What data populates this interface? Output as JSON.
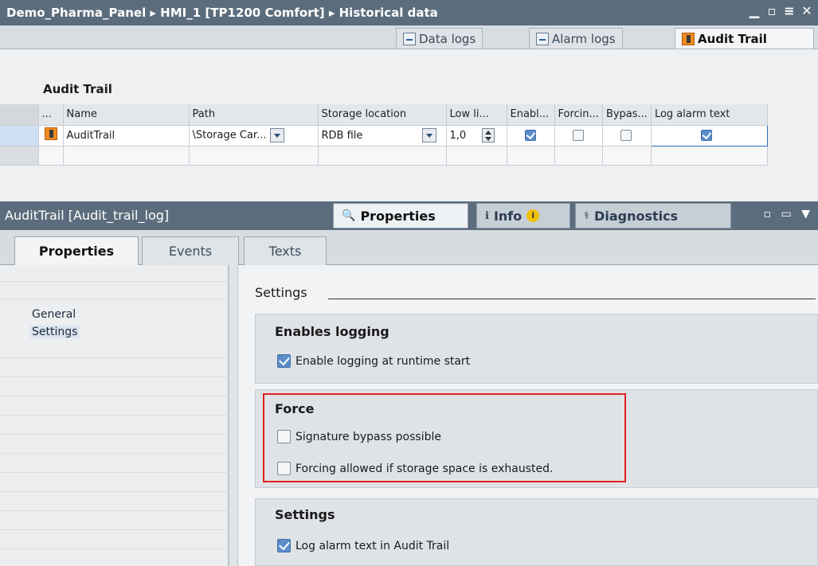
{
  "titlebar": {
    "title": "Demo_Pharma_Panel ▸ HMI_1 [TP1200 Comfort] ▸ Historical data",
    "controls": [
      "minimize",
      "restore",
      "float",
      "close"
    ]
  },
  "editor_tabs": [
    {
      "label": "Data logs",
      "icon": "data-log-icon"
    },
    {
      "label": "Alarm logs",
      "icon": "alarm-log-icon"
    },
    {
      "label": "Audit Trail",
      "icon": "audit-trail-icon",
      "active": true
    }
  ],
  "grid": {
    "title": "Audit Trail",
    "columns": [
      "...",
      "Name",
      "Path",
      "Storage location",
      "Low li...",
      "Enabl...",
      "Forcin...",
      "Bypas...",
      "Log alarm text"
    ],
    "rows": [
      {
        "name": "AuditTrail",
        "path": "\\Storage Car...",
        "storage": "RDB file",
        "low": "1,0",
        "enabled": true,
        "forcing": false,
        "bypass": false,
        "log_alarm_text": true
      }
    ]
  },
  "inspector": {
    "title": "AuditTrail [Audit_trail_log]",
    "tabs": [
      {
        "label": "Properties",
        "icon": "properties-icon",
        "active": true
      },
      {
        "label": "Info",
        "icon": "info-icon"
      },
      {
        "label": "Diagnostics",
        "icon": "diagnostics-icon"
      }
    ]
  },
  "prop_tabs": [
    "Properties",
    "Events",
    "Texts"
  ],
  "nav_items": [
    "General",
    "Settings"
  ],
  "settings": {
    "section_title": "Settings",
    "groups": [
      {
        "title": "Enables logging",
        "options": [
          {
            "label": "Enable logging at runtime start",
            "checked": true
          }
        ]
      },
      {
        "title": "Force",
        "options": [
          {
            "label": "Signature bypass possible",
            "checked": false
          },
          {
            "label": "Forcing allowed if storage space is exhausted.",
            "checked": false
          }
        ]
      },
      {
        "title": "Settings",
        "options": [
          {
            "label": "Log alarm text in Audit Trail",
            "checked": true
          }
        ]
      }
    ]
  },
  "colors": {
    "titlebar": "#5b6d7c",
    "highlight_box": "#e02020",
    "checkbox_on": "#5b8dc9"
  }
}
